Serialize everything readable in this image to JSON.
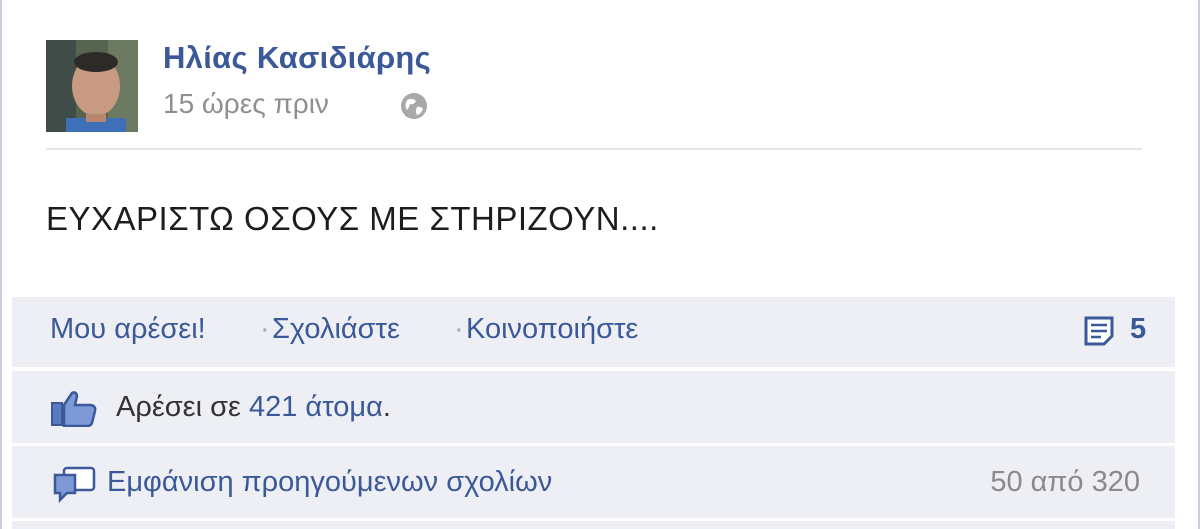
{
  "post": {
    "author_name": "Ηλίας Κασιδιάρης",
    "timestamp": "15 ώρες πριν",
    "privacy_icon": "globe-icon",
    "text": "ΕΥΧΑΡΙΣΤΩ ΟΣΟΥΣ ΜΕ ΣΤΗΡΙΖΟΥΝ...."
  },
  "actions": {
    "like_label": "Μου αρέσει!",
    "separator": "·",
    "comment_label": "Σχολιάστε",
    "share_label": "Κοινοποιήστε",
    "comment_count": "5",
    "comment_count_icon": "comments-icon"
  },
  "likes": {
    "icon": "thumbs-up-icon",
    "prefix": "Αρέσει σε ",
    "link": "421 άτομα",
    "suffix": "."
  },
  "comments": {
    "icon": "speech-bubble-icon",
    "view_previous_label": "Εμφάνιση προηγούμενων σχολίων",
    "range": "50 από 320"
  },
  "colors": {
    "link_blue": "#3b5998",
    "bar_background": "#edeff4",
    "muted_text": "#8f8f8f"
  }
}
